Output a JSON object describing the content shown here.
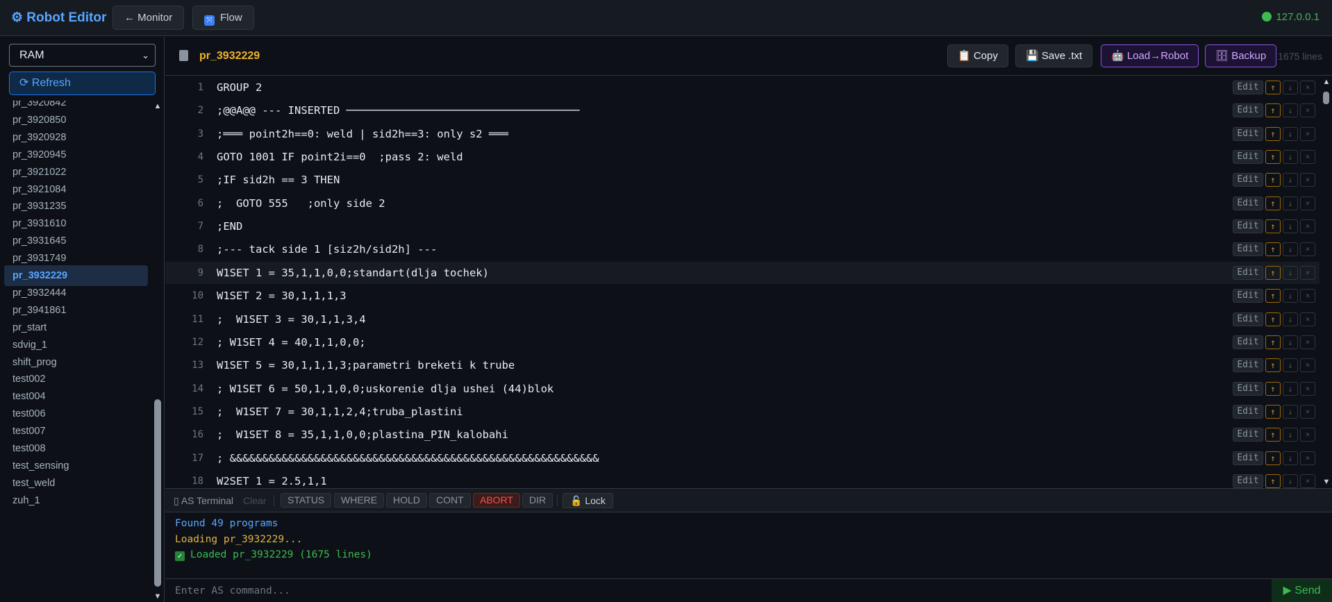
{
  "topbar": {
    "brand": "⚙ Robot Editor",
    "monitor_label": "← Monitor",
    "flow_label": "Flow",
    "connection": "127.0.0.1"
  },
  "sidebar": {
    "memory_select": "RAM",
    "refresh_label": "⟳ Refresh",
    "programs": [
      "pr_3920842",
      "pr_3920850",
      "pr_3920928",
      "pr_3920945",
      "pr_3921022",
      "pr_3921084",
      "pr_3931235",
      "pr_3931610",
      "pr_3931645",
      "pr_3931749",
      "pr_3932229",
      "pr_3932444",
      "pr_3941861",
      "pr_start",
      "sdvig_1",
      "shift_prog",
      "test002",
      "test004",
      "test006",
      "test007",
      "test008",
      "test_sensing",
      "test_weld",
      "zuh_1"
    ],
    "active_program": "pr_3932229"
  },
  "editor": {
    "file_name": "pr_3932229",
    "copy_label": "📋 Copy",
    "save_label": "💾 Save .txt",
    "load_label": "🤖 Load→Robot",
    "backup_label": "🗄 Backup",
    "line_count": "1675 lines",
    "edit_label": "Edit",
    "up_label": "↑",
    "down_label": "↓",
    "delete_label": "×",
    "highlighted_line": 9,
    "lines": [
      {
        "n": "1",
        "text": "GROUP 2"
      },
      {
        "n": "2",
        "text": ";@@A@@ --- INSERTED ────────────────────────────────────"
      },
      {
        "n": "3",
        "text": ";═══ point2h==0: weld | sid2h==3: only s2 ═══"
      },
      {
        "n": "4",
        "text": "GOTO 1001 IF point2i==0  ;pass 2: weld"
      },
      {
        "n": "5",
        "text": ";IF sid2h == 3 THEN"
      },
      {
        "n": "6",
        "text": ";  GOTO 555   ;only side 2"
      },
      {
        "n": "7",
        "text": ";END"
      },
      {
        "n": "8",
        "text": ";--- tack side 1 [siz2h/sid2h] ---"
      },
      {
        "n": "9",
        "text": "W1SET 1 = 35,1,1,0,0;standart(dlja tochek)"
      },
      {
        "n": "10",
        "text": "W1SET 2 = 30,1,1,1,3"
      },
      {
        "n": "11",
        "text": ";  W1SET 3 = 30,1,1,3,4"
      },
      {
        "n": "12",
        "text": "; W1SET 4 = 40,1,1,0,0;"
      },
      {
        "n": "13",
        "text": "W1SET 5 = 30,1,1,1,3;parametri breketi k trube"
      },
      {
        "n": "14",
        "text": "; W1SET 6 = 50,1,1,0,0;uskorenie dlja ushei (44)blok"
      },
      {
        "n": "15",
        "text": ";  W1SET 7 = 30,1,1,2,4;truba_plastini"
      },
      {
        "n": "16",
        "text": ";  W1SET 8 = 35,1,1,0,0;plastina_PIN_kalobahi"
      },
      {
        "n": "17",
        "text": "; &&&&&&&&&&&&&&&&&&&&&&&&&&&&&&&&&&&&&&&&&&&&&&&&&&&&&&&&&"
      },
      {
        "n": "18",
        "text": "W2SET 1 = 2.5,1,1"
      }
    ]
  },
  "terminal": {
    "title": "AS Terminal",
    "clear_label": "Clear",
    "commands": [
      "STATUS",
      "WHERE",
      "HOLD",
      "CONT",
      "ABORT",
      "DIR"
    ],
    "lock_label": "Lock",
    "output": [
      {
        "text": "Found 49 programs",
        "color": "#58a6ff"
      },
      {
        "text": "Loading pr_3932229...",
        "color": "#e3b341"
      },
      {
        "text": "Loaded pr_3932229 (1675 lines)",
        "color": "#3fb950",
        "ok": true
      }
    ],
    "input_placeholder": "Enter AS command...",
    "send_label": "▶ Send"
  }
}
